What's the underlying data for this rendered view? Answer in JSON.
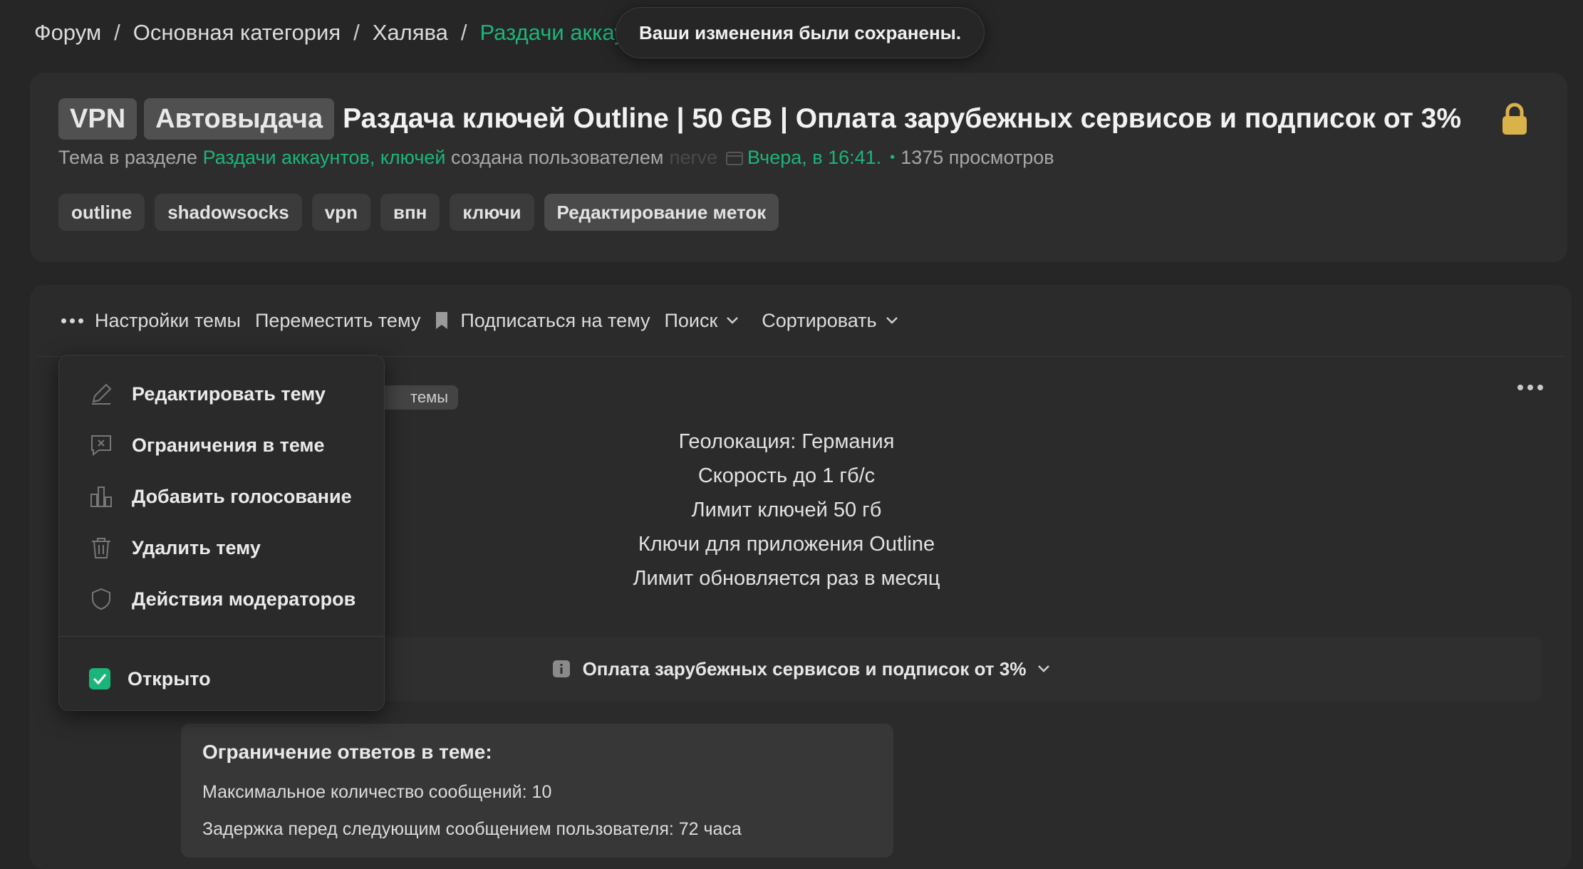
{
  "breadcrumb": {
    "items": [
      "Форум",
      "Основная категория",
      "Халява"
    ],
    "current": "Раздачи аккаунтов, ключей",
    "separator": "/"
  },
  "toast": {
    "message": "Ваши изменения были сохранены."
  },
  "thread": {
    "prefixes": [
      "VPN",
      "Автовыдача"
    ],
    "title": "Раздача ключей Outline | 50 GB | Оплата зарубежных сервисов и подписок от 3%",
    "meta": {
      "prefix_text": "Тема в разделе",
      "section": "Раздачи аккаунтов, ключей",
      "created_by": "создана пользователем",
      "author": "nerve",
      "date": "Вчера, в 16:41.",
      "views": "1375 просмотров"
    },
    "tags": [
      "outline",
      "shadowsocks",
      "vpn",
      "впн",
      "ключи"
    ],
    "edit_tags_label": "Редактирование меток"
  },
  "toolbar": {
    "settings": "Настройки темы",
    "move": "Переместить тему",
    "subscribe": "Подписаться на тему",
    "search": "Поиск",
    "sort": "Сортировать"
  },
  "dropdown": {
    "items": [
      "Редактировать тему",
      "Ограничения в теме",
      "Добавить голосование",
      "Удалить тему",
      "Действия модераторов"
    ],
    "open_label": "Открыто",
    "open_checked": true
  },
  "post": {
    "hidden_badge": "темы",
    "lines": [
      "Геолокация: Германия",
      "Скорость до 1 гб/с",
      "Лимит ключей 50 гб",
      "Ключи для приложения Outline",
      "Лимит обновляется раз в месяц"
    ],
    "spoiler_label": "Оплата зарубежных сервисов и подписок от 3%"
  },
  "restriction": {
    "title": "Ограничение ответов в теме:",
    "max_messages": "Максимальное количество сообщений: 10",
    "delay": "Задержка перед следующим сообщением пользователя: 72 часа"
  },
  "colors": {
    "accent": "#1bb57a",
    "lock": "#d9b24a",
    "background": "#262626"
  }
}
